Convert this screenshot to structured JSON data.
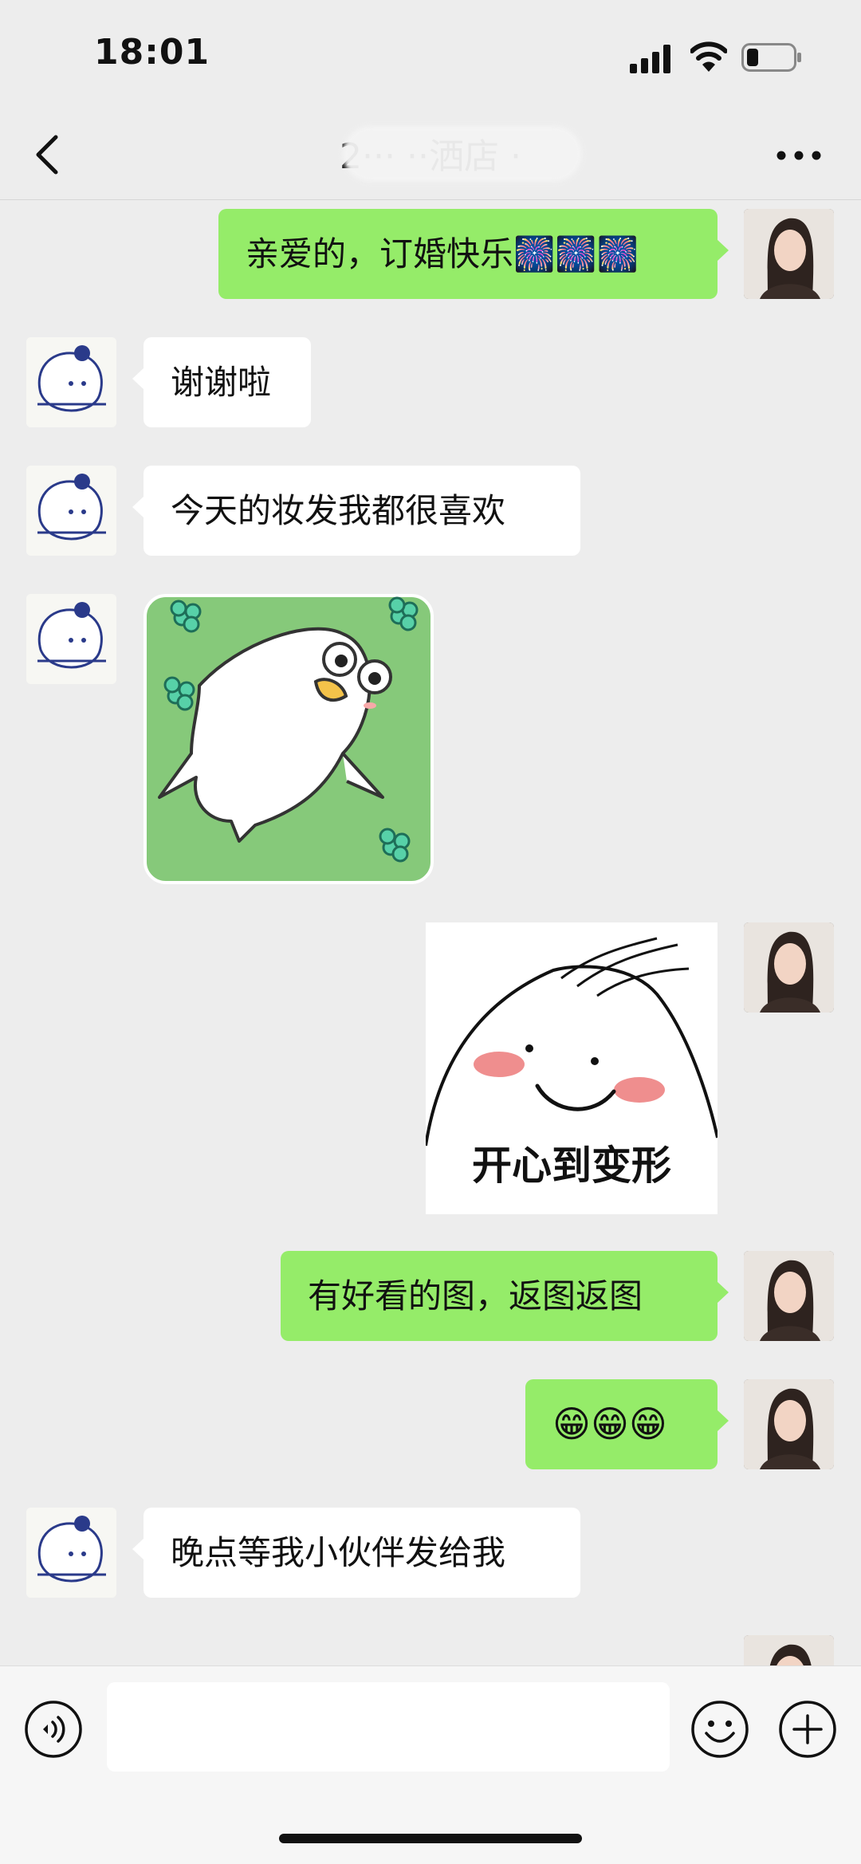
{
  "status_bar": {
    "time": "18:01"
  },
  "nav": {
    "title": "2··· ··洒店 ·"
  },
  "messages": [
    {
      "side": "right",
      "type": "text",
      "text": "亲爱的，订婚快乐🎆🎆🎆"
    },
    {
      "side": "left",
      "type": "text",
      "text": "谢谢啦"
    },
    {
      "side": "left",
      "type": "text",
      "text": "今天的妆发我都很喜欢"
    },
    {
      "side": "left",
      "type": "sticker",
      "icon": "duck-sticker"
    },
    {
      "side": "right",
      "type": "sticker",
      "icon": "happy-face-sticker",
      "caption": "开心到变形"
    },
    {
      "side": "right",
      "type": "text",
      "text": "有好看的图，返图返图"
    },
    {
      "side": "right",
      "type": "text",
      "text": "😁😁😁"
    },
    {
      "side": "left",
      "type": "text",
      "text": "晚点等我小伙伴发给我"
    }
  ],
  "colors": {
    "background": "#ededed",
    "outgoing_bubble": "#95ec69",
    "incoming_bubble": "#ffffff"
  }
}
